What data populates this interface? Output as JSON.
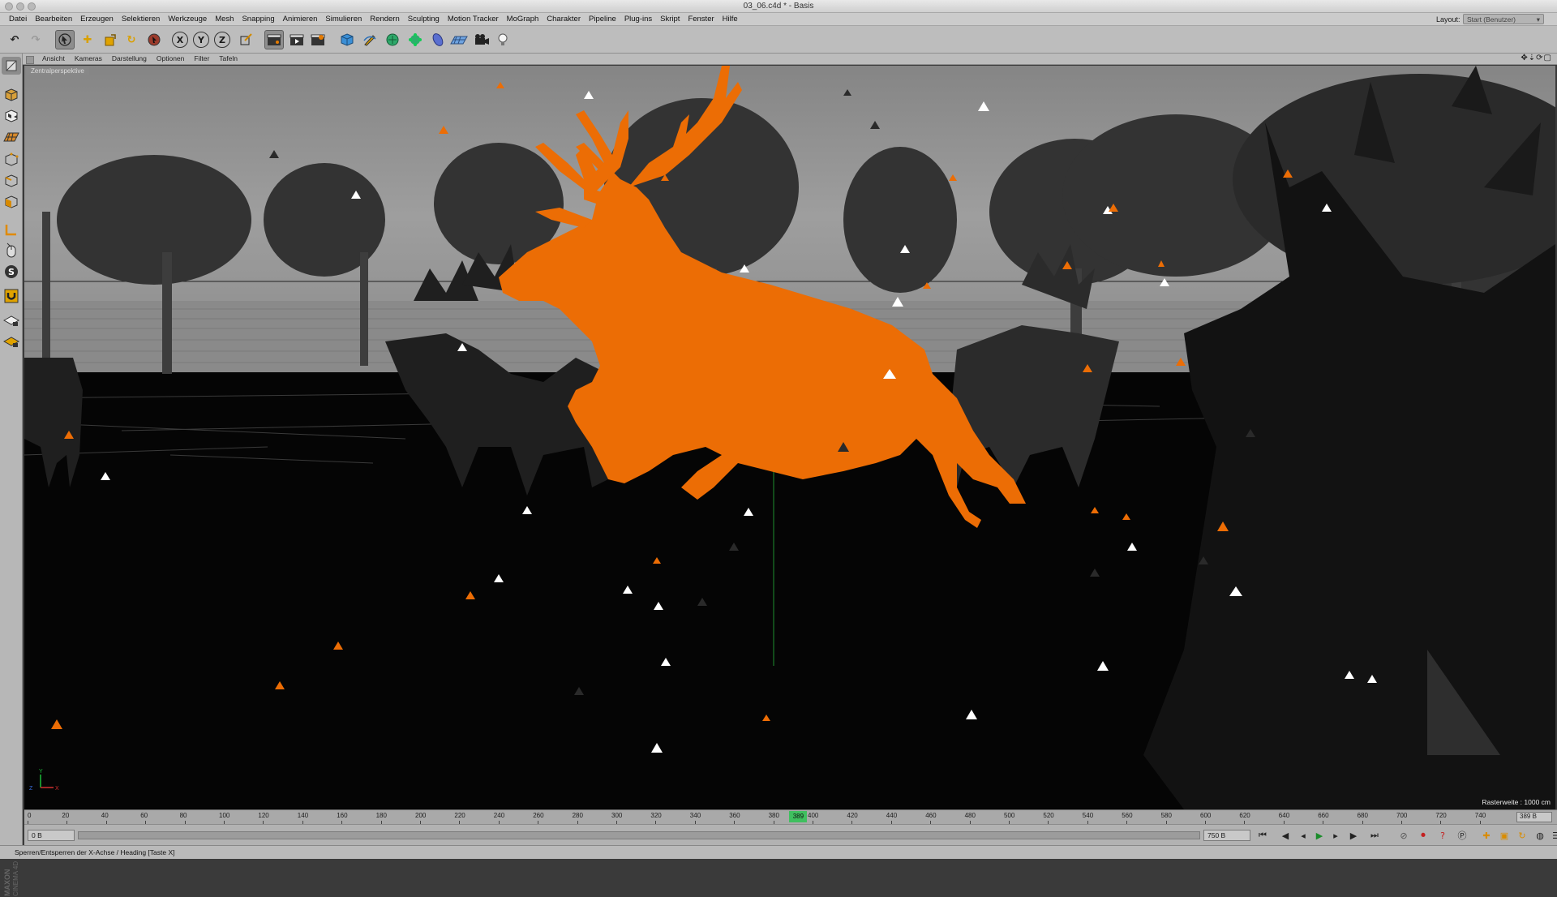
{
  "window": {
    "title": "03_06.c4d * - Basis"
  },
  "menu": [
    "Datei",
    "Bearbeiten",
    "Erzeugen",
    "Selektieren",
    "Werkzeuge",
    "Mesh",
    "Snapping",
    "Animieren",
    "Simulieren",
    "Rendern",
    "Sculpting",
    "Motion Tracker",
    "MoGraph",
    "Charakter",
    "Pipeline",
    "Plug-ins",
    "Skript",
    "Fenster",
    "Hilfe"
  ],
  "layout": {
    "label": "Layout:",
    "value": "Start (Benutzer)"
  },
  "toolbar": {
    "x_label": "X",
    "y_label": "Y",
    "z_label": "Z"
  },
  "viewport_menu": [
    "Ansicht",
    "Kameras",
    "Darstellung",
    "Optionen",
    "Filter",
    "Tafeln"
  ],
  "viewport": {
    "label": "Zentralperspektive",
    "raster": "Rasterweite : 1000 cm"
  },
  "timeline": {
    "ticks": [
      "0",
      "20",
      "40",
      "60",
      "80",
      "100",
      "120",
      "140",
      "160",
      "180",
      "200",
      "220",
      "240",
      "260",
      "280",
      "300",
      "320",
      "340",
      "360",
      "380",
      "400",
      "420",
      "440",
      "460",
      "480",
      "500",
      "520",
      "540",
      "560",
      "580",
      "600",
      "620",
      "640",
      "660",
      "680",
      "700",
      "720",
      "740"
    ],
    "current_frame": "389",
    "end_frame": "389 B"
  },
  "controls": {
    "start_field": "0 B",
    "end_field": "750 B",
    "preview_field": "750 B"
  },
  "statusbar": {
    "text": "Sperren/Entsperren der X-Achse / Heading [Taste X]"
  },
  "brand": {
    "line1": "MAXON",
    "line2": "CINEMA 4D"
  },
  "colors": {
    "accent": "#ec6d05",
    "viewport_bg": "#000000",
    "sky": "#9a9a9a",
    "ui_gray": "#bdbdbd"
  }
}
